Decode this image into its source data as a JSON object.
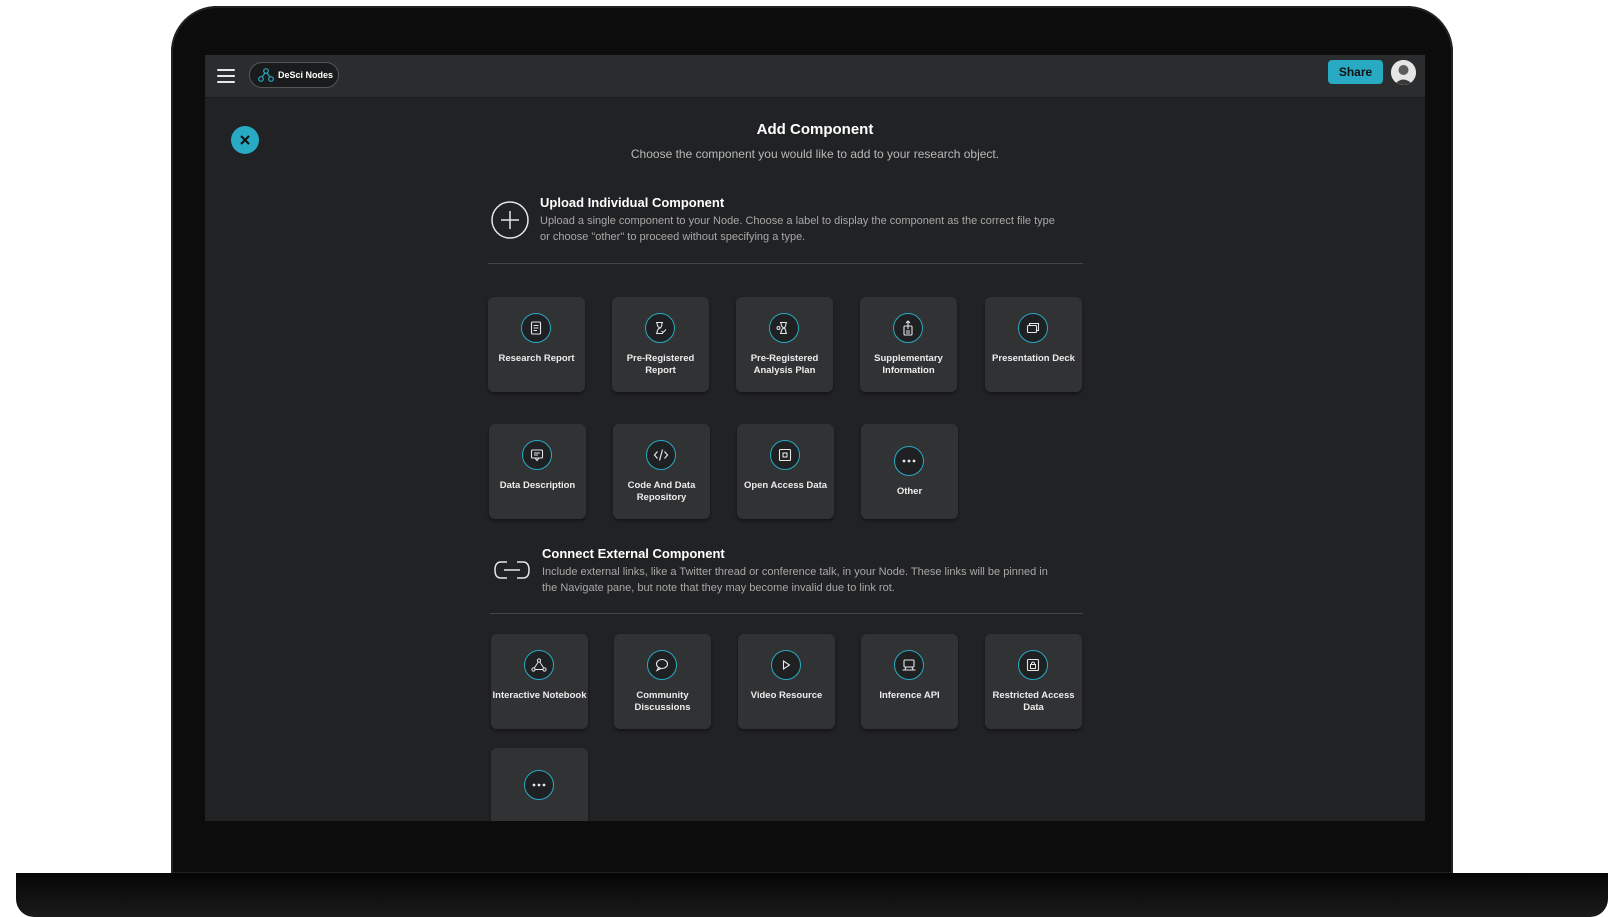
{
  "topbar": {
    "brand": "DeSci Nodes",
    "share_label": "Share"
  },
  "dialog": {
    "title": "Add Component",
    "subtitle": "Choose the component you would like to add to your research object."
  },
  "upload_section": {
    "title": "Upload Individual Component",
    "description": "Upload a single component to your Node. Choose a label to display the component as the correct file type or choose \"other\" to proceed without specifying a type.",
    "tiles": [
      {
        "label": "Research Report",
        "icon": "document-icon"
      },
      {
        "label": "Pre-Registered Report",
        "icon": "hourglass-check-icon"
      },
      {
        "label": "Pre-Registered Analysis Plan",
        "icon": "analysis-plan-icon"
      },
      {
        "label": "Supplementary Information",
        "icon": "upload-document-icon"
      },
      {
        "label": "Presentation Deck",
        "icon": "slides-icon"
      },
      {
        "label": "Data Description",
        "icon": "comment-box-icon"
      },
      {
        "label": "Code And Data Repository",
        "icon": "code-icon"
      },
      {
        "label": "Open Access Data",
        "icon": "open-box-icon"
      },
      {
        "label": "Other",
        "icon": "ellipsis-icon"
      }
    ]
  },
  "external_section": {
    "title": "Connect External Component",
    "description": "Include external links, like a Twitter thread or conference talk, in your Node. These links will be pinned in the Navigate pane, but note that they may become invalid due to link rot.",
    "tiles": [
      {
        "label": "Interactive Notebook",
        "icon": "network-icon"
      },
      {
        "label": "Community Discussions",
        "icon": "chat-bubble-icon"
      },
      {
        "label": "Video Resource",
        "icon": "play-icon"
      },
      {
        "label": "Inference API",
        "icon": "server-icon"
      },
      {
        "label": "Restricted Access Data",
        "icon": "lock-icon"
      },
      {
        "label": "",
        "icon": "ellipsis-icon"
      }
    ]
  },
  "colors": {
    "accent": "#28aac4",
    "background": "#212224",
    "tile": "#313234"
  }
}
